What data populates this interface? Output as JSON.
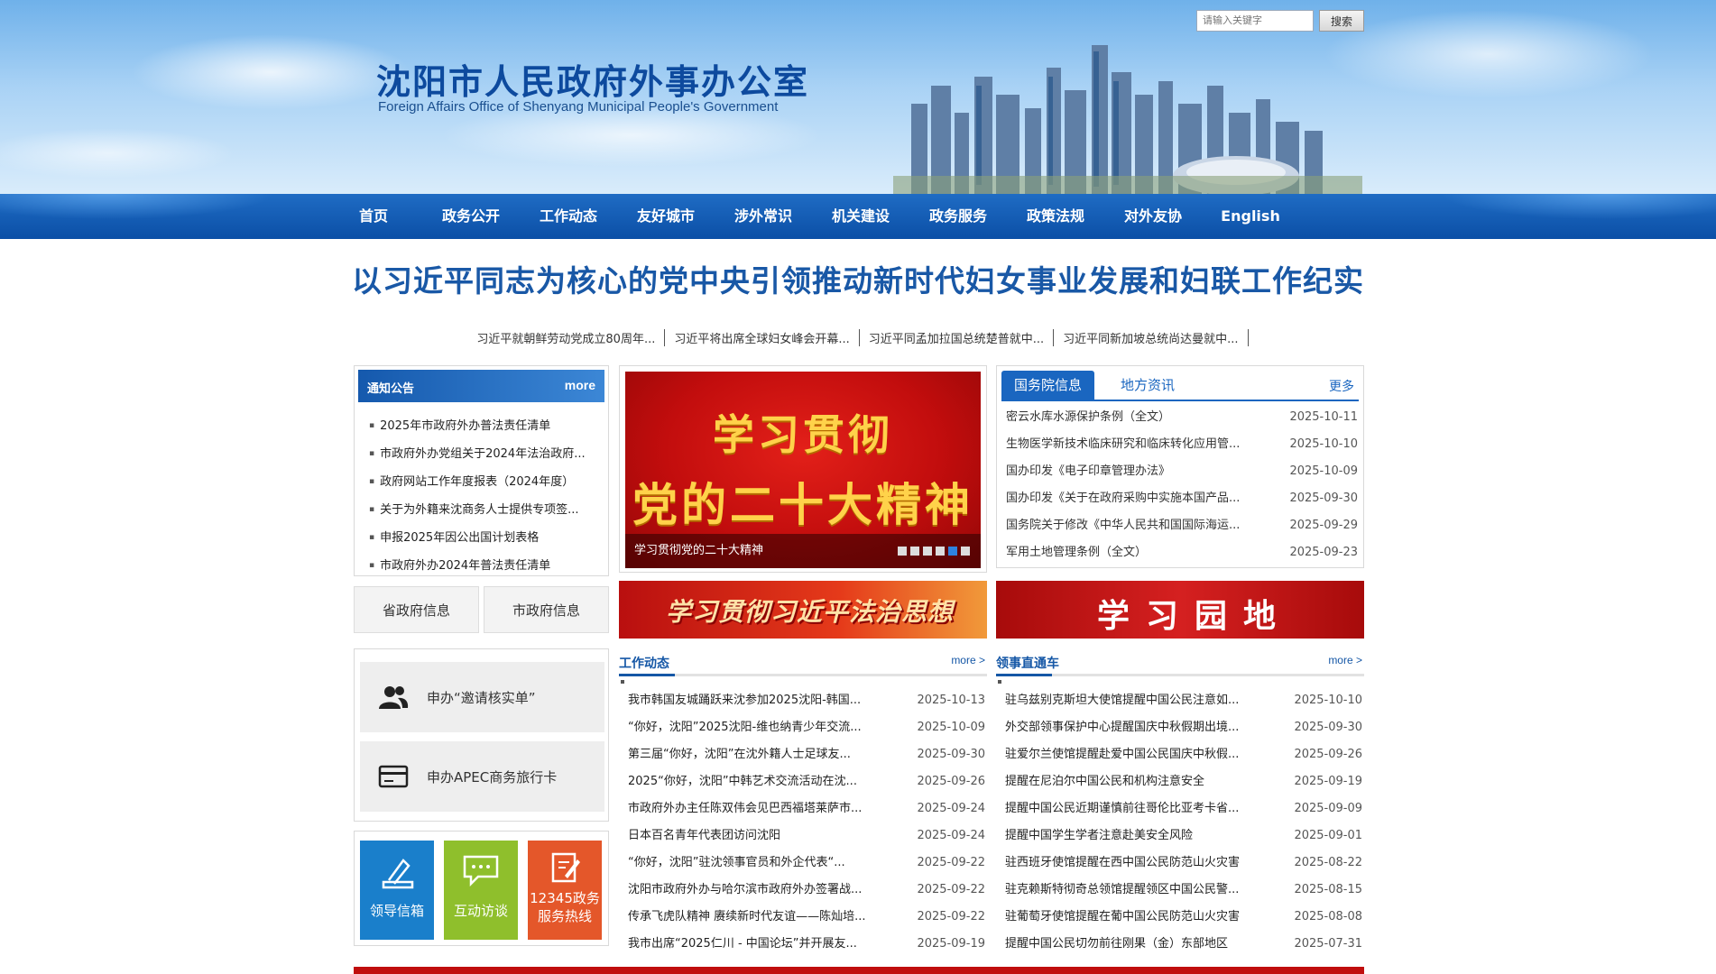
{
  "header": {
    "title": "沈阳市人民政府外事办公室",
    "subtitle": "Foreign Affairs Office of Shenyang Municipal People's Government",
    "search_placeholder": "请输入关键字",
    "search_button": "搜索"
  },
  "nav": [
    "首页",
    "政务公开",
    "工作动态",
    "友好城市",
    "涉外常识",
    "机关建设",
    "政务服务",
    "政策法规",
    "对外友协",
    "English"
  ],
  "headline": "以习近平同志为核心的党中央引领推动新时代妇女事业发展和妇联工作纪实",
  "subnews": [
    "习近平就朝鲜劳动党成立80周年...",
    "习近平将出席全球妇女峰会开幕...",
    "习近平同孟加拉国总统楚普就中...",
    "习近平同新加坡总统尚达曼就中..."
  ],
  "notice": {
    "title": "通知公告",
    "more": "more",
    "items": [
      "2025年市政府外办普法责任清单",
      "市政府外办党组关于2024年法治政府...",
      "政府网站工作年度报表（2024年度）",
      "关于为外籍来沈商务人士提供专项签...",
      "申报2025年因公出国计划表格",
      "市政府外办2024年普法责任清单"
    ]
  },
  "info_buttons": [
    "省政府信息",
    "市政府信息"
  ],
  "apply": [
    "申办“邀请核实单”",
    "申办APEC商务旅行卡"
  ],
  "tiles": [
    {
      "label": "领导信箱",
      "color": "#1a7fcb"
    },
    {
      "label": "互动访谈",
      "color": "#8fbf2c"
    },
    {
      "label_line1": "12345政务",
      "label_line2": "服务热线",
      "color": "#e4572a"
    }
  ],
  "slider": {
    "line1": "学习贯彻",
    "line2": "党的二十大精神",
    "caption": "学习贯彻党的二十大精神",
    "dot_count": 6,
    "active_dot": 5
  },
  "tabs": {
    "tab1": "国务院信息",
    "tab2": "地方资讯",
    "more": "更多",
    "items": [
      {
        "title": "密云水库水源保护条例（全文）",
        "date": "2025-10-11"
      },
      {
        "title": "生物医学新技术临床研究和临床转化应用管...",
        "date": "2025-10-10"
      },
      {
        "title": "国办印发《电子印章管理办法》",
        "date": "2025-10-09"
      },
      {
        "title": "国办印发《关于在政府采购中实施本国产品...",
        "date": "2025-09-30"
      },
      {
        "title": "国务院关于修改《中华人民共和国国际海运...",
        "date": "2025-09-29"
      },
      {
        "title": "军用土地管理条例（全文）",
        "date": "2025-09-23"
      }
    ]
  },
  "banners": {
    "left": "学习贯彻习近平法治思想",
    "right": "学习园地"
  },
  "work": {
    "title": "工作动态",
    "more": "more >",
    "items": [
      {
        "title": "我市韩国友城踊跃来沈参加2025沈阳-韩国...",
        "date": "2025-10-13"
      },
      {
        "title": "“你好，沈阳”2025沈阳-维也纳青少年交流...",
        "date": "2025-10-09"
      },
      {
        "title": "第三届“你好，沈阳”在沈外籍人士足球友...",
        "date": "2025-09-30"
      },
      {
        "title": "2025“你好，沈阳”中韩艺术交流活动在沈...",
        "date": "2025-09-26"
      },
      {
        "title": "市政府外办主任陈双伟会见巴西福塔莱萨市...",
        "date": "2025-09-24"
      },
      {
        "title": "日本百名青年代表团访问沈阳",
        "date": "2025-09-24"
      },
      {
        "title": "“你好，沈阳”驻沈领事官员和外企代表“...",
        "date": "2025-09-22"
      },
      {
        "title": "沈阳市政府外办与哈尔滨市政府外办签署战...",
        "date": "2025-09-22"
      },
      {
        "title": "传承飞虎队精神 赓续新时代友谊——陈灿培...",
        "date": "2025-09-22"
      },
      {
        "title": "我市出席“2025仁川 - 中国论坛”并开展友...",
        "date": "2025-09-19"
      }
    ]
  },
  "consular": {
    "title": "领事直通车",
    "more": "more >",
    "items": [
      {
        "title": "驻乌兹别克斯坦大使馆提醒中国公民注意如...",
        "date": "2025-10-10"
      },
      {
        "title": "外交部领事保护中心提醒国庆中秋假期出境...",
        "date": "2025-09-30"
      },
      {
        "title": "驻爱尔兰使馆提醒赴爱中国公民国庆中秋假...",
        "date": "2025-09-26"
      },
      {
        "title": "提醒在尼泊尔中国公民和机构注意安全",
        "date": "2025-09-19"
      },
      {
        "title": "提醒中国公民近期谨慎前往哥伦比亚考卡省...",
        "date": "2025-09-09"
      },
      {
        "title": "提醒中国学生学者注意赴美安全风险",
        "date": "2025-09-01"
      },
      {
        "title": "驻西班牙使馆提醒在西中国公民防范山火灾害",
        "date": "2025-08-22"
      },
      {
        "title": "驻克赖斯特彻奇总领馆提醒领区中国公民警...",
        "date": "2025-08-15"
      },
      {
        "title": "驻葡萄牙使馆提醒在葡中国公民防范山火灾害",
        "date": "2025-08-08"
      },
      {
        "title": "提醒中国公民切勿前往刚果（金）东部地区",
        "date": "2025-07-31"
      }
    ]
  }
}
